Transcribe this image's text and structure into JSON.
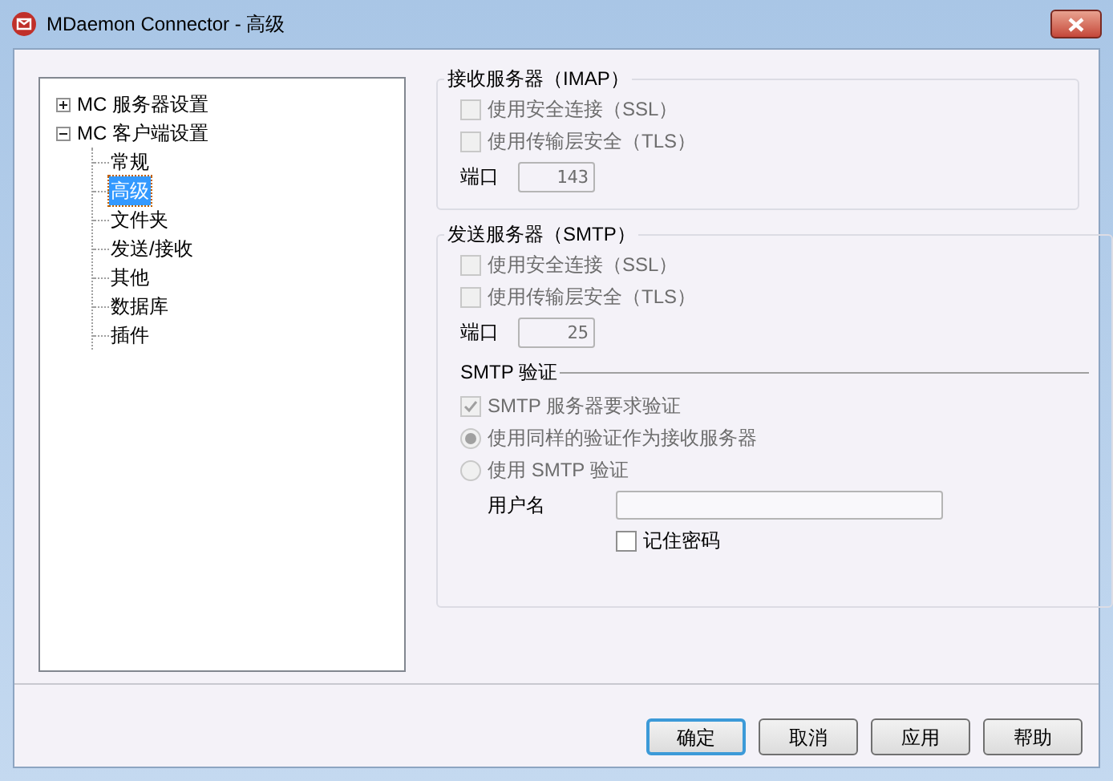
{
  "window": {
    "title": "MDaemon Connector - 高级"
  },
  "tree": [
    {
      "label": "MC 服务器设置",
      "expanded": false,
      "selected": false
    },
    {
      "label": "MC 客户端设置",
      "expanded": true,
      "selected": false,
      "children": [
        {
          "label": "常规",
          "selected": false
        },
        {
          "label": "高级",
          "selected": true
        },
        {
          "label": "文件夹",
          "selected": false
        },
        {
          "label": "发送/接收",
          "selected": false
        },
        {
          "label": "其他",
          "selected": false
        },
        {
          "label": "数据库",
          "selected": false
        },
        {
          "label": "插件",
          "selected": false
        }
      ]
    }
  ],
  "imap": {
    "title": "接收服务器（IMAP）",
    "options": [
      {
        "kind": "checkbox",
        "label": "使用安全连接（SSL）",
        "checked": false,
        "disabled": true
      },
      {
        "kind": "checkbox",
        "label": "使用传输层安全（TLS）",
        "checked": false,
        "disabled": true
      }
    ],
    "port": {
      "label": "端口",
      "value": "143",
      "disabled": true
    }
  },
  "smtp": {
    "title": "发送服务器（SMTP）",
    "options": [
      {
        "kind": "checkbox",
        "label": "使用安全连接（SSL）",
        "checked": false,
        "disabled": true
      },
      {
        "kind": "checkbox",
        "label": "使用传输层安全（TLS）",
        "checked": false,
        "disabled": true
      }
    ],
    "port": {
      "label": "端口",
      "value": "25",
      "disabled": true
    },
    "auth": {
      "title": "SMTP 验证",
      "items": [
        {
          "kind": "checkbox",
          "label": "SMTP 服务器要求验证",
          "checked": true,
          "disabled": true
        },
        {
          "kind": "radio",
          "label": "使用同样的验证作为接收服务器",
          "selected": true,
          "disabled": true
        },
        {
          "kind": "radio",
          "label": "使用 SMTP 验证",
          "selected": false,
          "disabled": true
        }
      ],
      "username": {
        "label": "用户名"
      },
      "remember": {
        "label": "记住密码",
        "checked": false,
        "disabled": false
      }
    }
  },
  "buttons": [
    {
      "label": "确定",
      "default": true
    },
    {
      "label": "取消",
      "default": false
    },
    {
      "label": "应用",
      "default": false
    },
    {
      "label": "帮助",
      "default": false
    }
  ]
}
